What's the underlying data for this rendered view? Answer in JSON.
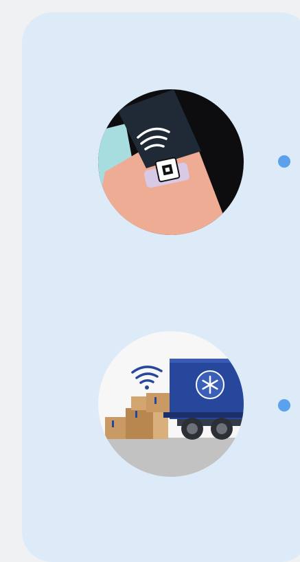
{
  "colors": {
    "page_background": "#f0f1f3",
    "card_background": "#ddebf8",
    "bullet_dot": "#5ba1ec",
    "truck_blue": "#27479c",
    "box_tan": "#c99a63",
    "skin": "#efac95",
    "dark_band": "#1f2a36"
  },
  "features": [
    {
      "illustration": "wearable-nfc-tag-on-wrist",
      "icons": [
        "wifi-signal-icon",
        "sensor-tag-icon"
      ]
    },
    {
      "illustration": "refrigerated-truck-with-packages",
      "icons": [
        "wifi-signal-icon",
        "snowflake-icon"
      ]
    }
  ]
}
